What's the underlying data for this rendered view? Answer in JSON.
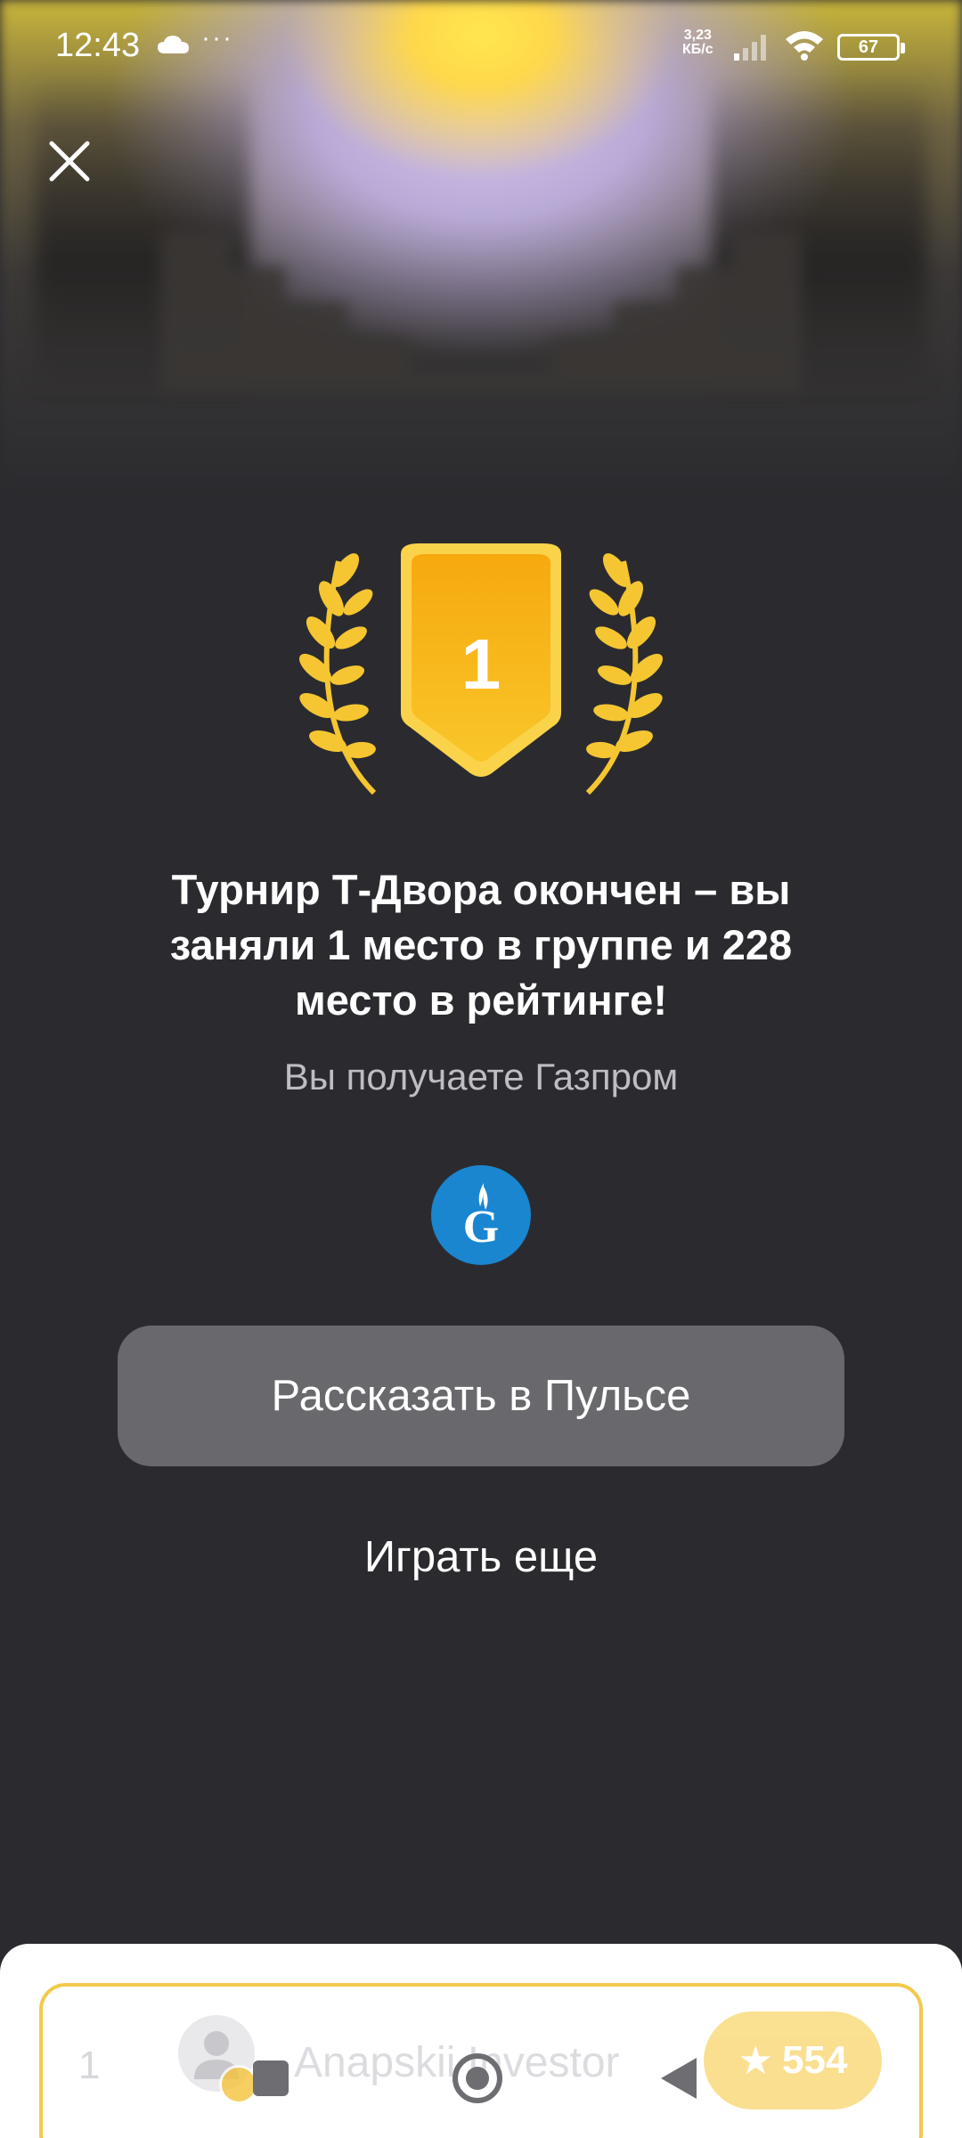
{
  "status_bar": {
    "time": "12:43",
    "more_indicator": "···",
    "net_speed_value": "3,23",
    "net_speed_unit": "КБ/с",
    "battery": "67"
  },
  "result": {
    "place_number": "1",
    "headline": "Турнир Т-Двора окончен – вы заняли 1 место в группе и 228 место в рейтинге!",
    "reward_text": "Вы получаете Газпром"
  },
  "actions": {
    "share_label": "Рассказать в Пульсе",
    "play_again_label": "Играть еще"
  },
  "leaderboard_row": {
    "rank": "1",
    "username": "Anapskii Investor",
    "score": "554"
  },
  "colors": {
    "background": "#2b2b2f",
    "medal_gold": "#f5b800",
    "button_gray": "#68686d",
    "gazprom_blue": "#1a86d0",
    "accent_yellow": "#f2c94c"
  }
}
